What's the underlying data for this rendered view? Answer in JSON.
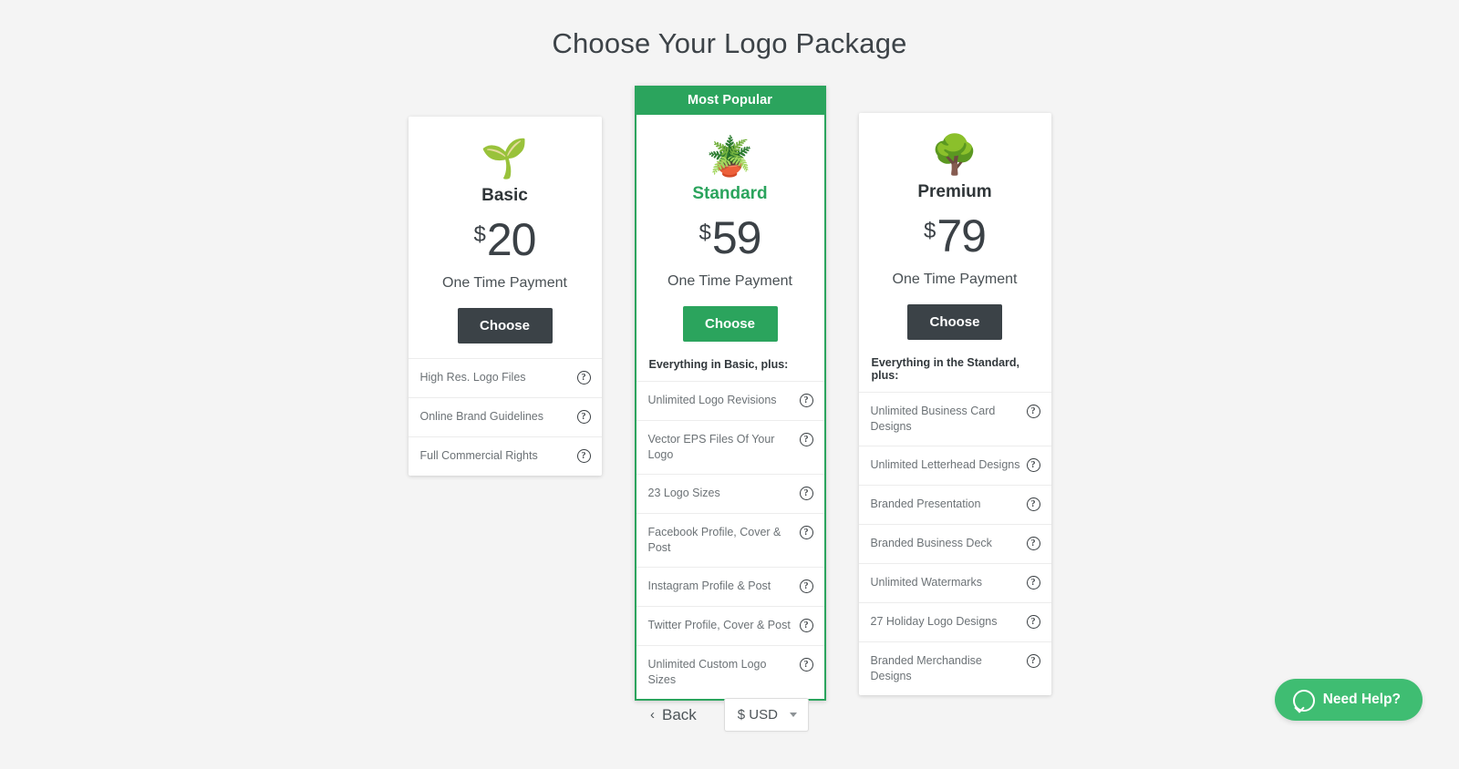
{
  "header": {
    "title": "Choose Your Logo Package"
  },
  "plans": {
    "basic": {
      "emoji": "🌱",
      "icon_name": "seedling-icon",
      "name": "Basic",
      "currency_symbol": "$",
      "price": "20",
      "payment_note": "One Time Payment",
      "cta": "Choose",
      "features": [
        "High Res. Logo Files",
        "Online Brand Guidelines",
        "Full Commercial Rights"
      ]
    },
    "standard": {
      "badge": "Most Popular",
      "emoji": "🪴",
      "icon_name": "potted-plant-icon",
      "name": "Standard",
      "currency_symbol": "$",
      "price": "59",
      "payment_note": "One Time Payment",
      "cta": "Choose",
      "plus_line": "Everything in Basic, plus:",
      "accent_color": "#2ba45d",
      "features": [
        "Unlimited Logo Revisions",
        "Vector EPS Files Of Your Logo",
        "23 Logo Sizes",
        "Facebook Profile, Cover & Post",
        "Instagram Profile & Post",
        "Twitter Profile, Cover & Post",
        "Unlimited Custom Logo Sizes"
      ]
    },
    "premium": {
      "emoji": "🌳",
      "icon_name": "tree-icon",
      "name": "Premium",
      "currency_symbol": "$",
      "price": "79",
      "payment_note": "One Time Payment",
      "cta": "Choose",
      "plus_line": "Everything in the Standard, plus:",
      "features": [
        "Unlimited Business Card Designs",
        "Unlimited Letterhead Designs",
        "Branded Presentation",
        "Branded Business Deck",
        "Unlimited Watermarks",
        "27 Holiday Logo Designs",
        "Branded Merchandise Designs"
      ]
    }
  },
  "help_icon_glyph": "?",
  "footer": {
    "back_label": "Back",
    "back_chevron": "‹",
    "currency_label": "$ USD"
  },
  "support_widget": {
    "label": "Need Help?",
    "color": "#3fbd72"
  }
}
